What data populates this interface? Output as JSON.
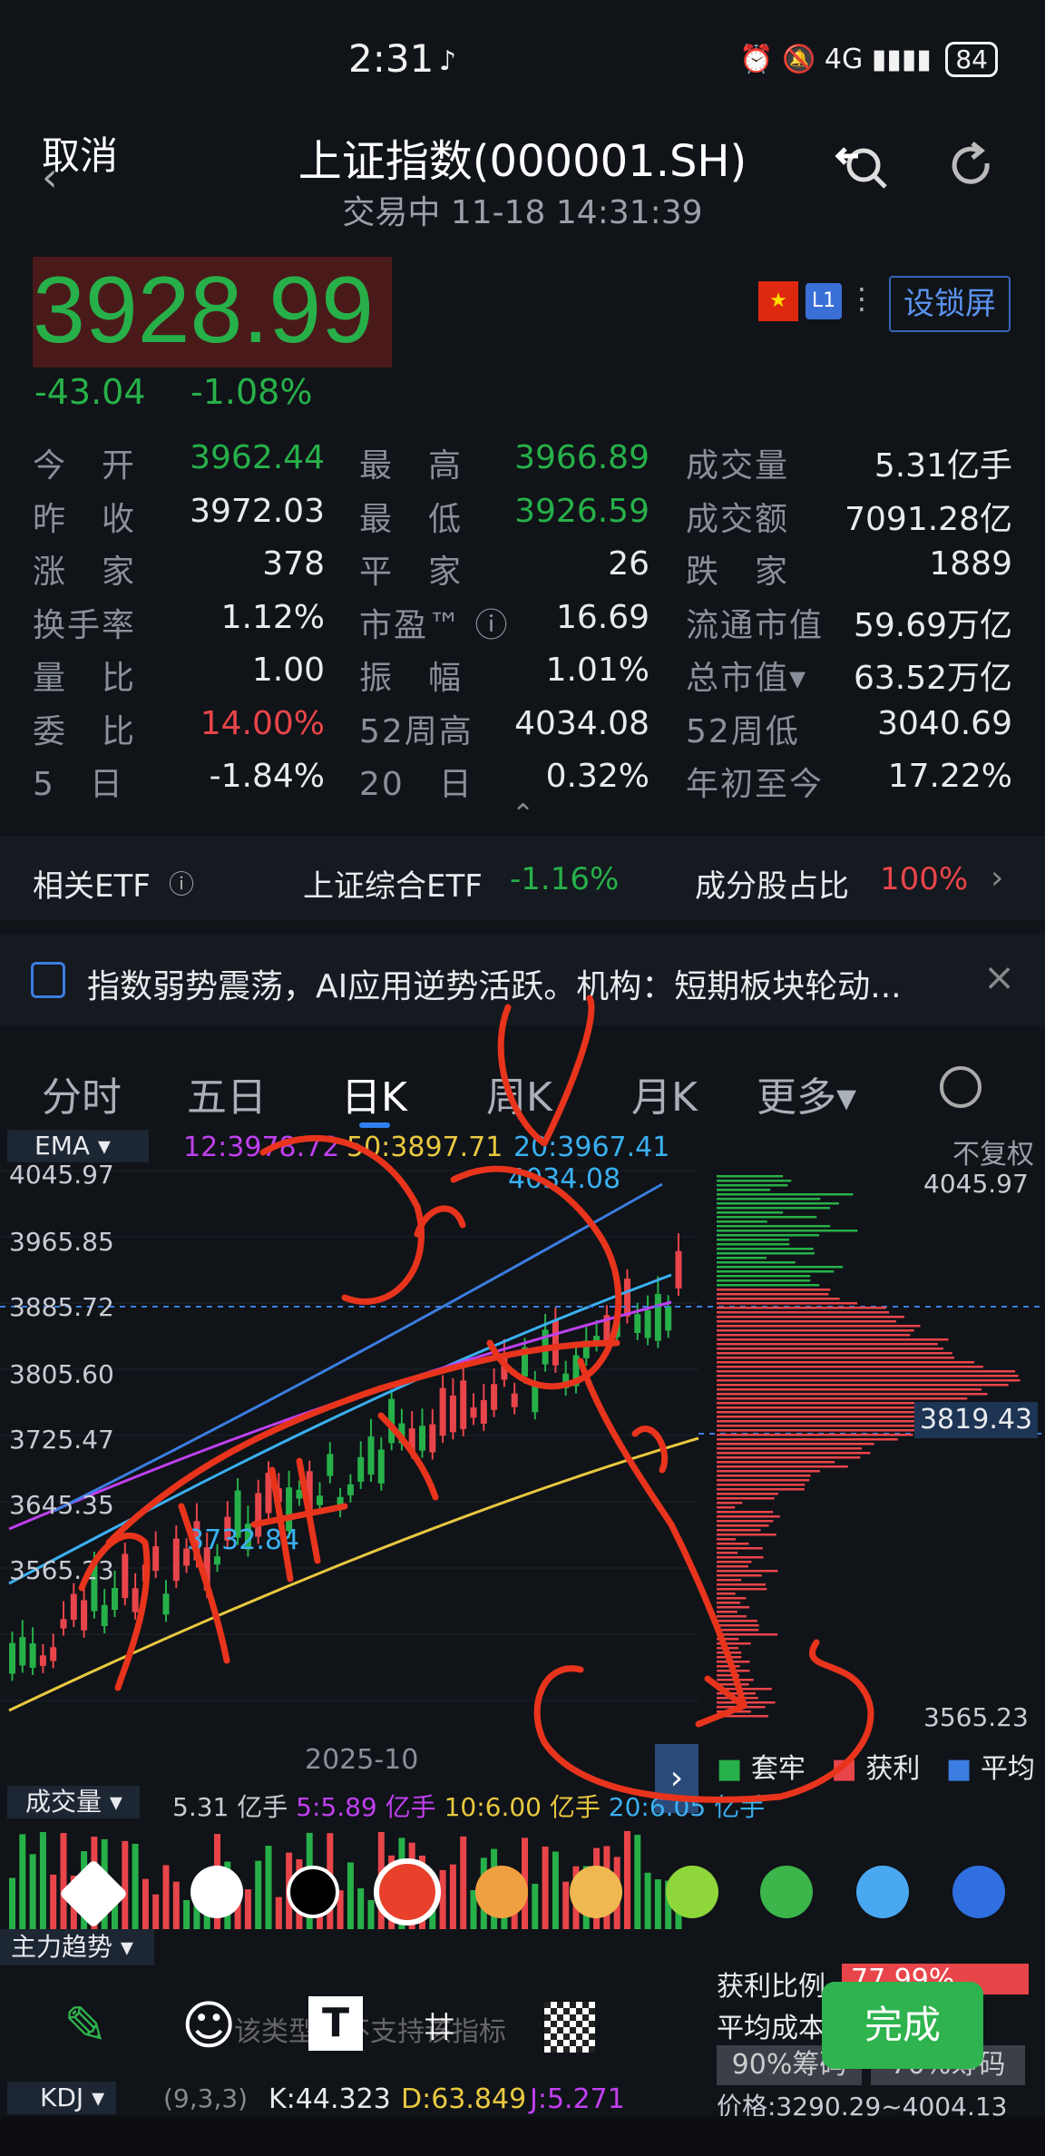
{
  "status_bar": {
    "time": "2:31",
    "app_mark": "♪",
    "network": "⏰ 🔕 4G ▮▮▮▮",
    "battery": "84"
  },
  "header": {
    "cancel": "取消",
    "title": "上证指数(000001.SH)",
    "subtitle": "交易中 11-18 14:31:39",
    "search_icon": "search-icon",
    "refresh_icon": "refresh-icon"
  },
  "quote": {
    "price": "3928.99",
    "change": "-43.04",
    "change_pct": "-1.08%",
    "flag_icon": "china-flag-icon",
    "l1": "L1",
    "lock_screen": "设锁屏",
    "colors": {
      "down": "#27b049",
      "up": "#e8454a"
    }
  },
  "stats": [
    [
      {
        "label": "今　开",
        "value": "3962.44"
      },
      {
        "label": "最　高",
        "value": "3966.89"
      },
      {
        "label": "成交量",
        "value": "5.31亿手"
      }
    ],
    [
      {
        "label": "昨　收",
        "value": "3972.03"
      },
      {
        "label": "最　低",
        "value": "3926.59"
      },
      {
        "label": "成交额",
        "value": "7091.28亿"
      }
    ],
    [
      {
        "label": "涨　家",
        "value": "378"
      },
      {
        "label": "平　家",
        "value": "26"
      },
      {
        "label": "跌　家",
        "value": "1889"
      }
    ],
    [
      {
        "label": "换手率",
        "value": "1.12%"
      },
      {
        "label": "市盈™ ⓘ",
        "value": "16.69"
      },
      {
        "label": "流通市值",
        "value": "59.69万亿"
      }
    ],
    [
      {
        "label": "量　比",
        "value": "1.00"
      },
      {
        "label": "振　幅",
        "value": "1.01%"
      },
      {
        "label": "总市值▾",
        "value": "63.52万亿"
      }
    ],
    [
      {
        "label": "委　比",
        "value": "14.00%"
      },
      {
        "label": "52周高",
        "value": "4034.08"
      },
      {
        "label": "52周低",
        "value": "3040.69"
      }
    ],
    [
      {
        "label": "5　日",
        "value": "-1.84%"
      },
      {
        "label": "20　日",
        "value": "0.32%"
      },
      {
        "label": "年初至今",
        "value": "17.22%"
      }
    ]
  ],
  "etf": {
    "label": "相关ETF",
    "info": "ⓘ",
    "name": "上证综合ETF",
    "value": "-1.16%",
    "component_label": "成分股占比",
    "component_value": "100%",
    "chevron": "›"
  },
  "news": {
    "text": "指数弱势震荡，AI应用逆势活跃。机构：短期板块轮动...",
    "close": "×"
  },
  "tabs": [
    "分时",
    "五日",
    "日K",
    "周K",
    "月K",
    "更多▾"
  ],
  "ema": {
    "select": "EMA ▾",
    "ema12": "12:3978.72",
    "ema50": "50:3897.71",
    "ema20": "20:3967.41",
    "adjust": "不复权"
  },
  "chart_data": {
    "type": "candlestick",
    "y_labels_left": [
      "4045.97",
      "3965.85",
      "3885.72",
      "3805.60",
      "3725.47",
      "3645.35",
      "3565.23"
    ],
    "y_labels_right": [
      "4045.97",
      "3565.23"
    ],
    "high_marker": "4034.08",
    "low_marker": "3732.84",
    "current_tag": "3819.43",
    "x_label": "2025-10",
    "legend": [
      "套牢",
      "获利",
      "平均"
    ],
    "ylim": [
      3565.23,
      4045.97
    ]
  },
  "volume": {
    "select": "成交量 ▾",
    "total": "5.31 亿手",
    "ma5": "5:5.89 亿手",
    "ma10": "10:6.00 亿手",
    "ma20": "20:6.05 亿手"
  },
  "palette": {
    "colors": [
      "#ffffff",
      "#000000",
      "#e8402a",
      "#f0a040",
      "#f0b850",
      "#8ed63a",
      "#3cb54a",
      "#4aa8f0",
      "#2f6fe0"
    ]
  },
  "main_force": "主力趋势 ▾",
  "profit": {
    "ratio_label": "获利比例",
    "ratio_value": "77.99%",
    "avg_cost_label": "平均成本",
    "cost_90": "90%筹码",
    "cost_70": "70%筹码",
    "price_range": "价格:3290.29~4004.13"
  },
  "toolbar": {
    "tools": [
      "pen-icon",
      "emoji-icon",
      "text-icon",
      "crop-icon",
      "mosaic-icon"
    ],
    "done": "完成",
    "hint": "该类型暂不支持该指标"
  },
  "kdj": {
    "select": "KDJ ▾",
    "params": "(9,3,3)",
    "k": "K:44.323",
    "d": "D:63.849",
    "j": "J:5.271"
  }
}
